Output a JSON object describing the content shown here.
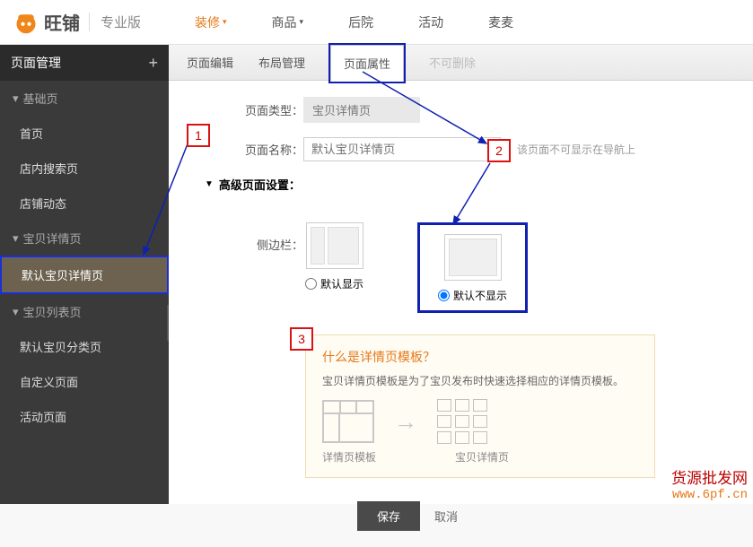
{
  "brand": "旺铺",
  "edition": "专业版",
  "topnav": {
    "decorate": "装修",
    "goods": "商品",
    "backyard": "后院",
    "activity": "活动",
    "maimai": "麦麦"
  },
  "sidebar": {
    "header": "页面管理",
    "groups": {
      "basic": "基础页",
      "itemdetail": "宝贝详情页",
      "itemlist": "宝贝列表页"
    },
    "items": {
      "home": "首页",
      "search": "店内搜索页",
      "dynamic": "店铺动态",
      "default_detail": "默认宝贝详情页",
      "default_cat": "默认宝贝分类页",
      "custom": "自定义页面",
      "activity": "活动页面"
    }
  },
  "tabs": {
    "edit": "页面编辑",
    "layout": "布局管理",
    "attr": "页面属性",
    "nodel": "不可删除"
  },
  "form": {
    "type_label": "页面类型：",
    "type_value": "宝贝详情页",
    "name_label": "页面名称：",
    "name_placeholder": "默认宝贝详情页",
    "name_hint": "该页面不可显示在导航上",
    "adv_header": "高级页面设置：",
    "sidebar_label": "侧边栏：",
    "opt_show": "默认显示",
    "opt_hide": "默认不显示"
  },
  "info": {
    "title": "什么是详情页模板？",
    "text": "宝贝详情页模板是为了宝贝发布时快速选择相应的详情页模板。",
    "lbl_tmpl": "详情页模板",
    "lbl_pages": "宝贝详情页"
  },
  "actions": {
    "save": "保存",
    "cancel": "取消"
  },
  "callouts": {
    "c1": "1",
    "c2": "2",
    "c3": "3"
  },
  "watermark": {
    "line1": "货源批发网",
    "line2": "www.6pf.cn"
  }
}
